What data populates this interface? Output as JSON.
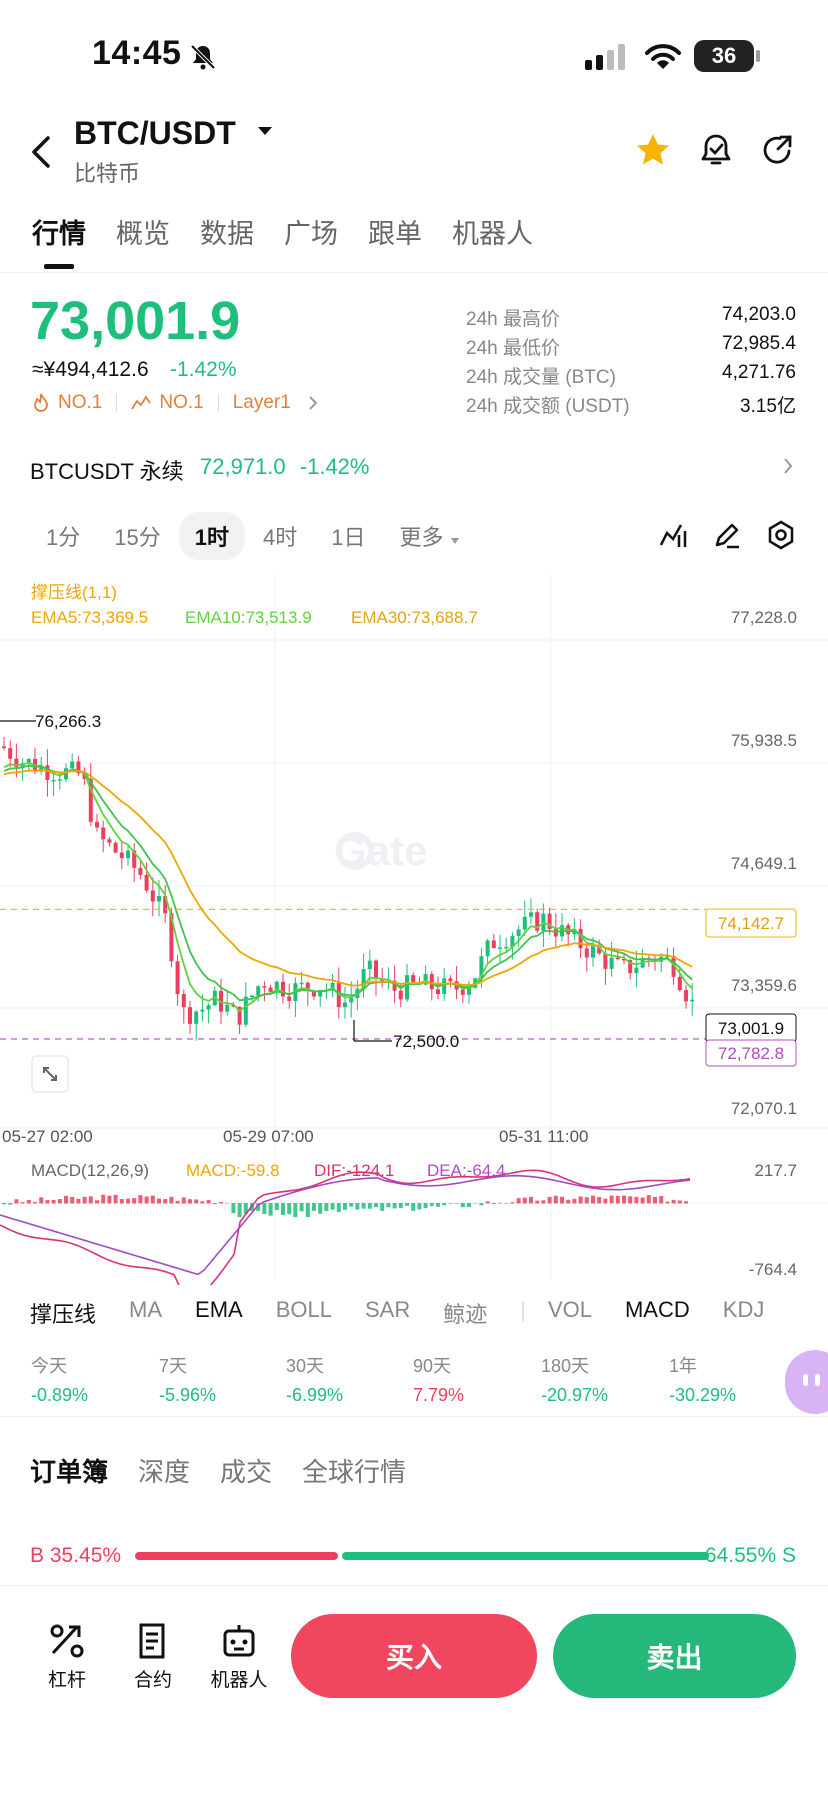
{
  "status_bar": {
    "time": "14:45",
    "battery": "36"
  },
  "header": {
    "pair": "BTC/USDT",
    "subtitle": "比特币"
  },
  "tabs": [
    "行情",
    "概览",
    "数据",
    "广场",
    "跟单",
    "机器人"
  ],
  "ticker": {
    "price": "73,001.9",
    "cny": "≈¥494,412.6",
    "change": "-1.42%",
    "tag1": "NO.1",
    "tag2": "NO.1",
    "tag3": "Layer1",
    "stats": [
      {
        "label": "24h 最高价",
        "value": "74,203.0"
      },
      {
        "label": "24h 最低价",
        "value": "72,985.4"
      },
      {
        "label": "24h 成交量 (BTC)",
        "value": "4,271.76"
      },
      {
        "label": "24h 成交额 (USDT)",
        "value": "3.15亿"
      }
    ]
  },
  "perpetual": {
    "name": "BTCUSDT 永续",
    "price": "72,971.0",
    "change": "-1.42%"
  },
  "intervals": [
    "1分",
    "15分",
    "1时",
    "4时",
    "1日",
    "更多"
  ],
  "chart": {
    "indicator_title": "撑压线(1,1)",
    "ema5": "EMA5:73,369.5",
    "ema10": "EMA10:73,513.9",
    "ema30": "EMA30:73,688.7",
    "y_ticks": [
      "77,228.0",
      "75,938.5",
      "74,649.1",
      "73,359.6",
      "72,070.1"
    ],
    "high_label": "76,266.3",
    "low_label": "72,500.0",
    "resistance": "74,142.7",
    "current": "73,001.9",
    "support": "72,782.8",
    "x_ticks": [
      "05-27 02:00",
      "05-29 07:00",
      "05-31 11:00"
    ],
    "watermark": "Gate",
    "macd_title": "MACD(12,26,9)",
    "macd": "MACD:-59.8",
    "dif": "DIF:-124.1",
    "dea": "DEA:-64.4",
    "macd_top": "217.7",
    "macd_bottom": "-764.4",
    "colors": {
      "up": "#1dbf7a",
      "down": "#ee3e5d",
      "ema5": "#f0a500",
      "ema10": "#5fd33f",
      "ema30": "#f3b21a"
    }
  },
  "indicators": [
    "撑压线",
    "MA",
    "EMA",
    "BOLL",
    "SAR",
    "鲸迹",
    "VOL",
    "MACD",
    "KDJ"
  ],
  "performance": [
    {
      "label": "今天",
      "value": "-0.89%",
      "up": false
    },
    {
      "label": "7天",
      "value": "-5.96%",
      "up": false
    },
    {
      "label": "30天",
      "value": "-6.99%",
      "up": false
    },
    {
      "label": "90天",
      "value": "7.79%",
      "up": true
    },
    {
      "label": "180天",
      "value": "-20.97%",
      "up": false
    },
    {
      "label": "1年",
      "value": "-30.29%",
      "up": false
    }
  ],
  "orderbook_tabs": [
    "订单簿",
    "深度",
    "成交",
    "全球行情"
  ],
  "ratio": {
    "buy": "B 35.45%",
    "sell": "64.55% S",
    "buy_fraction": 0.3545
  },
  "bottom": {
    "leverage": "杠杆",
    "contract": "合约",
    "robot": "机器人",
    "buy": "买入",
    "sell": "卖出"
  }
}
